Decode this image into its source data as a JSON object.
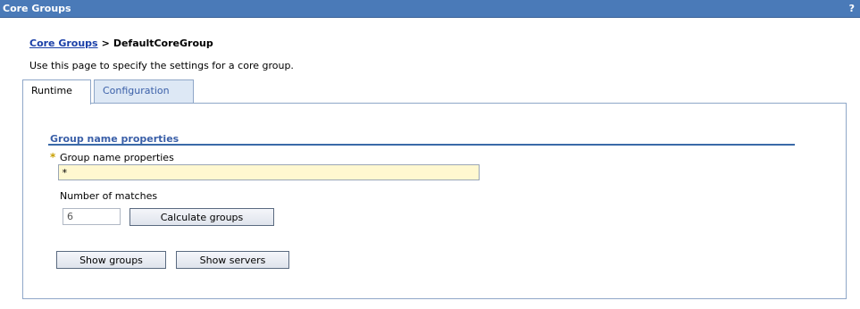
{
  "window": {
    "title": "Core Groups",
    "help_label": "?"
  },
  "breadcrumb": {
    "parent_label": "Core Groups",
    "separator": ">",
    "current_label": "DefaultCoreGroup"
  },
  "description": "Use this page to specify the settings for a core group.",
  "tabs": [
    {
      "label": "Runtime",
      "active": true
    },
    {
      "label": "Configuration",
      "active": false
    }
  ],
  "section": {
    "title": "Group name properties"
  },
  "form": {
    "required_marker": "*",
    "group_name_label": "Group name properties",
    "group_name_value": "*",
    "matches_label": "Number of matches",
    "matches_value": "6"
  },
  "buttons": {
    "calculate_label": "Calculate groups",
    "show_groups_label": "Show groups",
    "show_servers_label": "Show servers"
  },
  "colors": {
    "titlebar": "#4a7ab8",
    "link": "#1a3fa8",
    "section_title": "#3a5fa8",
    "required_input_bg": "#fff8d0"
  }
}
